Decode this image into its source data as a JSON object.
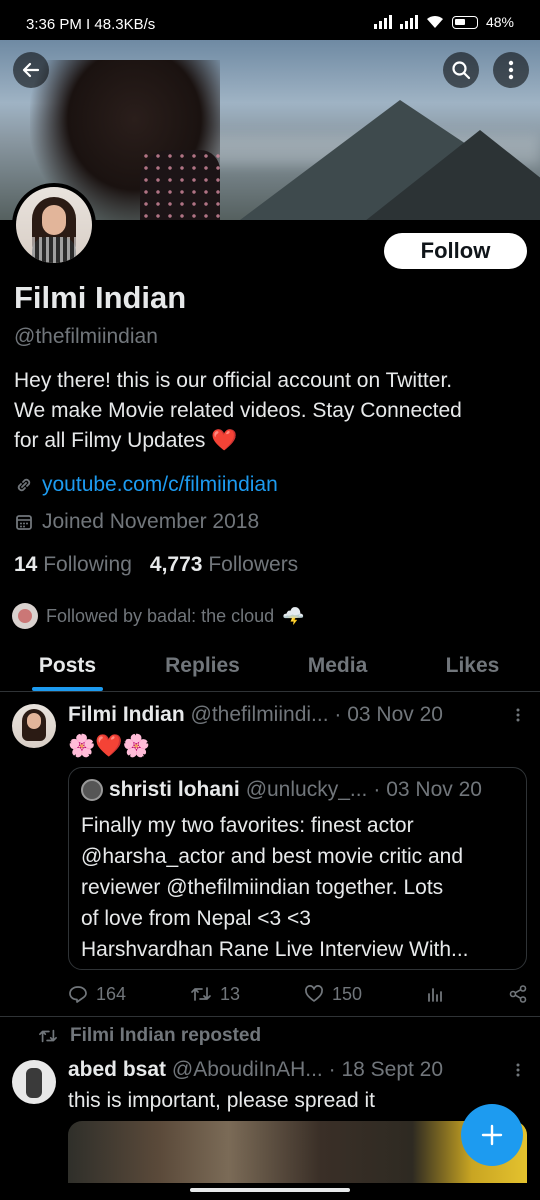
{
  "status_bar": {
    "time": "3:36 PM",
    "speed": "48.3KB/s",
    "battery": "48"
  },
  "profile": {
    "name": "Filmi Indian",
    "handle": "@thefilmiindian",
    "bio_line1": "Hey there! this is our official account on Twitter.",
    "bio_line2": "We make Movie related videos. Stay Connected",
    "bio_line3": "for all Filmy Updates",
    "bio_emoji": "❤️",
    "link": "youtube.com/c/filmiindian",
    "joined": "Joined November 2018",
    "following_count": "14",
    "following_label": "Following",
    "followers_count": "4,773",
    "followers_label": "Followers",
    "followed_by": "Followed by badal: the cloud",
    "followed_by_emoji": "🌩️",
    "follow_button": "Follow"
  },
  "tabs": [
    "Posts",
    "Replies",
    "Media",
    "Likes"
  ],
  "tweet1": {
    "name": "Filmi Indian",
    "handle": "@thefilmiindi...",
    "date": "· 03 Nov 20",
    "text": "🌸❤️🌸",
    "quote": {
      "name": "shristi lohani",
      "handle": "@unlucky_...",
      "date": "· 03 Nov 20",
      "line1": "Finally my two favorites: finest actor",
      "line2": "@harsha_actor and best movie critic and",
      "line3": "reviewer @thefilmiindian  together. Lots",
      "line4": "of love from Nepal <3 <3",
      "line5": "Harshvardhan Rane Live Interview With..."
    },
    "replies": "164",
    "reposts": "13",
    "likes": "150"
  },
  "repost_label": "Filmi Indian reposted",
  "tweet2": {
    "name": "abed bsat",
    "handle": "@AboudiInAH...",
    "date": "· 18 Sept 20",
    "text": "this is important, please spread it"
  },
  "colors": {
    "accent": "#1d9bf0",
    "like": "#f91880",
    "muted": "#71767b",
    "text": "#e7e9ea",
    "background": "#000000"
  },
  "icons": [
    "back-arrow-icon",
    "search-icon",
    "more-vertical-icon",
    "link-icon",
    "calendar-icon",
    "reply-icon",
    "repost-icon",
    "like-icon",
    "views-icon",
    "share-icon",
    "plus-icon"
  ]
}
